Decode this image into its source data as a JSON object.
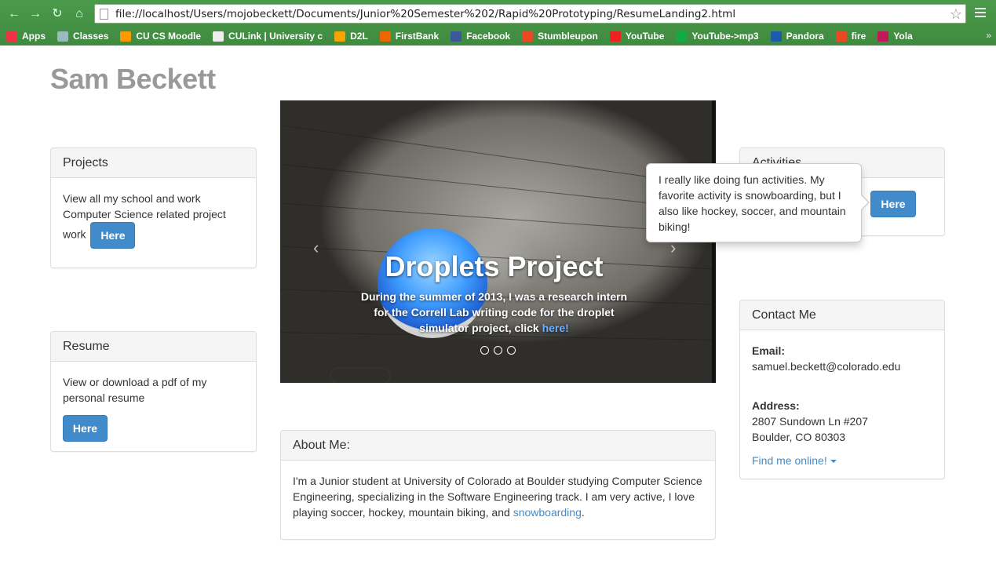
{
  "browser": {
    "url": "file://localhost/Users/mojobeckett/Documents/Junior%20Semester%202/Rapid%20Prototyping/ResumeLanding2.html",
    "bookmarks": [
      {
        "label": "Apps",
        "icon": "apps-grid-icon",
        "color": "#e34"
      },
      {
        "label": "Classes",
        "icon": "folder-icon",
        "color": "#9bb"
      },
      {
        "label": "CU CS Moodle",
        "icon": "moodle-icon",
        "color": "#f90"
      },
      {
        "label": "CULink | University c",
        "icon": "page-icon",
        "color": "#eee"
      },
      {
        "label": "D2L",
        "icon": "d2l-icon",
        "color": "#f7a400"
      },
      {
        "label": "FirstBank",
        "icon": "firstbank-icon",
        "color": "#e60"
      },
      {
        "label": "Facebook",
        "icon": "facebook-icon",
        "color": "#3b5998"
      },
      {
        "label": "Stumbleupon",
        "icon": "stumbleupon-icon",
        "color": "#eb4924"
      },
      {
        "label": "YouTube",
        "icon": "youtube-icon",
        "color": "#e22"
      },
      {
        "label": "YouTube->mp3",
        "icon": "ytmp3-icon",
        "color": "#1a4"
      },
      {
        "label": "Pandora",
        "icon": "pandora-icon",
        "color": "#1d5aa8"
      },
      {
        "label": "fire",
        "icon": "fire-icon",
        "color": "#eb4924"
      },
      {
        "label": "Yola",
        "icon": "yola-icon",
        "color": "#c2185b"
      }
    ],
    "more": "»"
  },
  "page": {
    "title": "Sam Beckett",
    "projects": {
      "heading": "Projects",
      "text": "View all my school and work Computer Science related project work",
      "button": "Here"
    },
    "resume": {
      "heading": "Resume",
      "text": "View or download a pdf of my personal resume",
      "button": "Here"
    },
    "carousel": {
      "title": "Droplets Project",
      "text": "During the summer of 2013, I was a research intern for the Correll Lab writing code for the droplet simulator project, click ",
      "link": "here!",
      "prev": "‹",
      "next": "›"
    },
    "about": {
      "heading": "About Me:",
      "text": "I'm a Junior student at University of Colorado at Boulder studying Computer Science Engineering, specializing in the Software Engineering track. I am very active, I love playing soccer, hockey, mountain biking, and ",
      "link": "snowboarding",
      "end": "."
    },
    "activities": {
      "heading": "Activities",
      "button": "Here",
      "popover": "I really like doing fun activities. My favorite activity is snowboarding, but I also like hockey, soccer, and mountain biking!"
    },
    "contact": {
      "heading": "Contact Me",
      "email_label": "Email:",
      "email": "samuel.beckett@colorado.edu",
      "address_label": "Address:",
      "address_line1": "2807 Sundown Ln #207",
      "address_line2": "Boulder, CO 80303",
      "online": "Find me online!"
    }
  }
}
